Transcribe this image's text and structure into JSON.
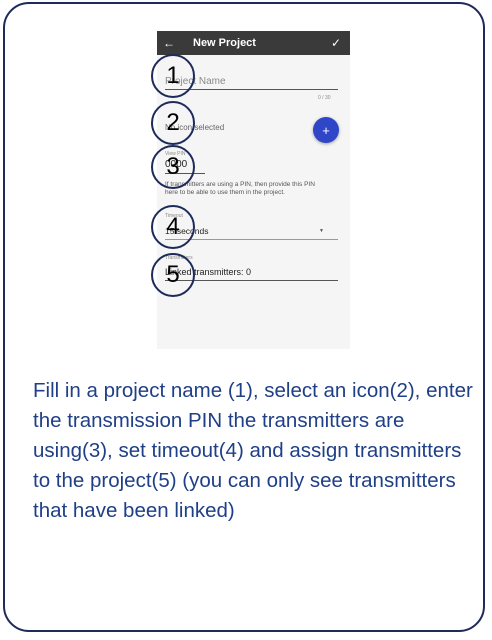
{
  "app_bar": {
    "back_icon": "←",
    "title": "New Project",
    "confirm_icon": "✓"
  },
  "form": {
    "project_name_placeholder": "Project Name",
    "char_counter": "0 / 30",
    "icon_status": "No icon selected",
    "add_icon_label": "+",
    "view_pin_label": "View PIN",
    "view_pin_value": "0000",
    "pin_help": "If transmitters are using a PIN, then provide this PIN here to be able to use them in the project.",
    "timeout_label": "Timeout",
    "timeout_value": "15 seconds",
    "transmitters_label": "Transmitters",
    "linked_transmitters": "Linked transmitters: 0"
  },
  "markers": [
    "1",
    "2",
    "3",
    "4",
    "5"
  ],
  "caption": "Fill in a project name (1), select an icon(2), enter the transmission PIN the transmitters are using(3), set timeout(4) and assign transmitters to the project(5) (you can only see transmitters that have been linked)",
  "colors": {
    "frame": "#1e2a5a",
    "caption_text": "#1f3f86",
    "app_bar": "#3a3a3a",
    "fab": "#2f46c8"
  }
}
